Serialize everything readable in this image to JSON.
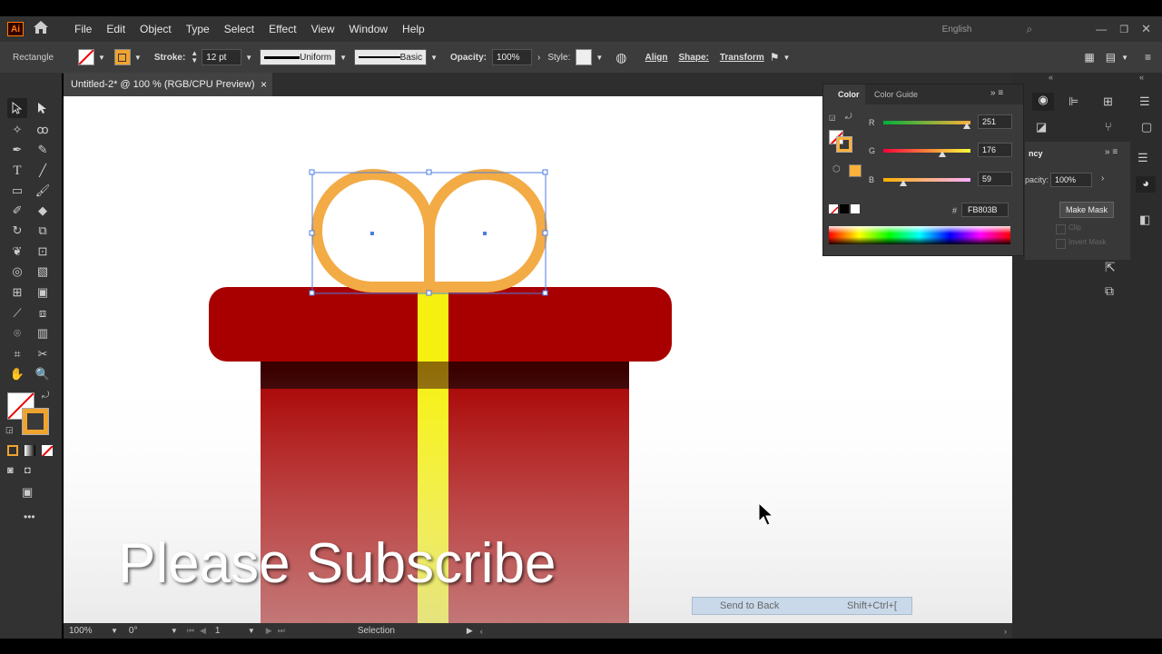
{
  "app": {
    "logo": "Ai",
    "home_icon": "home-icon"
  },
  "menu": [
    "File",
    "Edit",
    "Object",
    "Type",
    "Select",
    "Effect",
    "View",
    "Window",
    "Help"
  ],
  "topright": {
    "language": "English"
  },
  "control": {
    "selection_type": "Rectangle",
    "stroke_label": "Stroke:",
    "stroke_weight": "12 pt",
    "profile1": "Uniform",
    "profile2": "Basic",
    "opacity_label": "Opacity:",
    "opacity_value": "100%",
    "style_label": "Style:",
    "align_label": "Align",
    "shape_label": "Shape:",
    "transform_label": "Transform",
    "stroke_color": "#f0a430"
  },
  "document": {
    "tab_title": "Untitled-2* @ 100 % (RGB/CPU Preview)",
    "close": "×"
  },
  "color_panel": {
    "tab_color": "Color",
    "tab_guide": "Color Guide",
    "r_label": "R",
    "r_value": "251",
    "r_fraction": 0.984,
    "g_label": "G",
    "g_value": "176",
    "g_fraction": 0.69,
    "b_label": "B",
    "b_value": "59",
    "b_fraction": 0.231,
    "hex_label": "#",
    "hex_value": "FB803B",
    "current_color": "#fbb03b"
  },
  "transparency_panel": {
    "tab": "ncy",
    "opacity_label": "pacity:",
    "opacity_value": "100%",
    "make_mask": "Make Mask",
    "clip": "Clip",
    "invert_mask": "Invert Mask"
  },
  "status": {
    "zoom": "100%",
    "rotation": "0°",
    "artboard": "1",
    "tool": "Selection"
  },
  "tooltip": {
    "label": "Send to Back",
    "shortcut": "Shift+Ctrl+["
  },
  "overlay": {
    "text": "Please Subscribe"
  },
  "artwork": {
    "box_color": "#a80000",
    "box_dark_band": "#3a0000",
    "ribbon_color": "#f5f010",
    "bow_color": "#f3ab45"
  }
}
